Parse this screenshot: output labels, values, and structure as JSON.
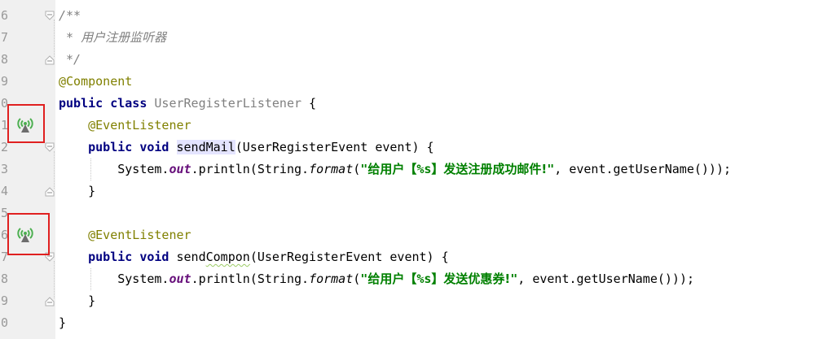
{
  "editor": {
    "line_numbers": [
      "6",
      "7",
      "8",
      "9",
      "0",
      "1",
      "2",
      "3",
      "4",
      "5",
      "6",
      "7",
      "8",
      "9",
      "0"
    ],
    "code": {
      "doc_open": "/**",
      "doc_star": " * ",
      "doc_text": "用户注册监听器",
      "doc_close": " */",
      "class_annotation": "@Component",
      "kw_public": "public",
      "kw_class": "class",
      "class_name": "UserRegisterListener",
      "open_brace": " {",
      "method_annotation": "@EventListener",
      "kw_void": "void",
      "method1_name": "sendMail",
      "param_open": "(UserRegisterEvent event) {",
      "system": "System.",
      "field_out": "out",
      "println_open": ".println(String.",
      "format_call": "format",
      "paren_open": "(",
      "str1_q1": "\"",
      "str1_cn_a": "给用户【",
      "str_ph": "%s",
      "str1_cn_b": "】发送注册成功邮件!",
      "str_q2": "\"",
      "args_tail": ", event.getUserName()));",
      "str2_cn_b": "】发送优惠券!",
      "close_brace": "}",
      "method2_prefix": "send",
      "method2_typo": "Compon",
      "param_open2": "(UserRegisterEvent event) {"
    }
  },
  "gutter_markers": [
    {
      "icon": "event-listener-icon"
    },
    {
      "icon": "event-listener-icon"
    }
  ],
  "colors": {
    "keyword": "#000080",
    "annotation": "#808000",
    "string": "#008000",
    "comment": "#808080",
    "field": "#660e7a",
    "marker_border": "#e02020",
    "icon_green": "#4caf50"
  }
}
